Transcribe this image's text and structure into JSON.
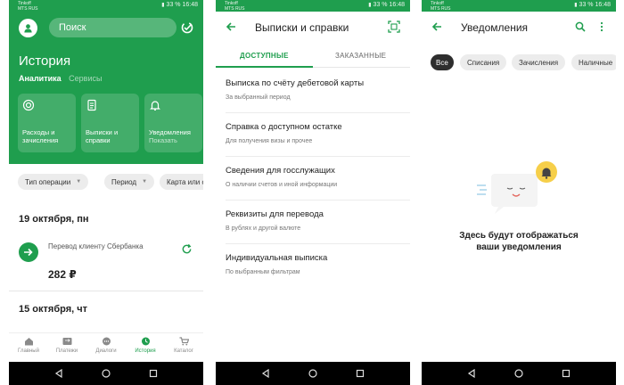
{
  "colors": {
    "brand": "#1f9e4e",
    "chip_bg": "#ececec",
    "chip_selected": "#2e2e2e"
  },
  "status_bar": {
    "operator_1": "Tinkoff",
    "operator_2": "MTS RUS",
    "battery": "33 %",
    "time": "16:48"
  },
  "screen1": {
    "search_placeholder": "Поиск",
    "title": "История",
    "tabs": [
      "Аналитика",
      "Сервисы"
    ],
    "tiles": [
      {
        "label": "Расходы и зачисления",
        "icon": "target-icon"
      },
      {
        "label": "Выписки и справки",
        "icon": "document-icon"
      },
      {
        "label": "Уведомления",
        "sub": "Показать",
        "icon": "bell-icon"
      }
    ],
    "filters": [
      "Тип операции",
      "Период",
      "Карта или сч"
    ],
    "date1": "19 октября, пн",
    "transaction": {
      "name": "Перевод клиенту Сбербанка",
      "amount": "282 ₽"
    },
    "date2": "15 октября, чт",
    "nav": [
      "Главный",
      "Платежи",
      "Диалоги",
      "История",
      "Каталог"
    ],
    "nav_active": "История"
  },
  "screen2": {
    "title": "Выписки и справки",
    "tabs": [
      "ДОСТУПНЫЕ",
      "ЗАКАЗАННЫЕ"
    ],
    "items": [
      {
        "title": "Выписка по счёту дебетовой карты",
        "sub": "За выбранный период"
      },
      {
        "title": "Справка о доступном остатке",
        "sub": "Для получения визы и прочее"
      },
      {
        "title": "Сведения для госслужащих",
        "sub": "О наличии счетов и иной информации"
      },
      {
        "title": "Реквизиты для перевода",
        "sub": "В рублях и другой валюте"
      },
      {
        "title": "Индивидуальная выписка",
        "sub": "По выбранным фильтрам"
      }
    ]
  },
  "screen3": {
    "title": "Уведомления",
    "chips": [
      "Все",
      "Списания",
      "Зачисления",
      "Наличные"
    ],
    "selected_chip": "Все",
    "empty_line1": "Здесь будут отображаться",
    "empty_line2": "ваши уведомления"
  }
}
